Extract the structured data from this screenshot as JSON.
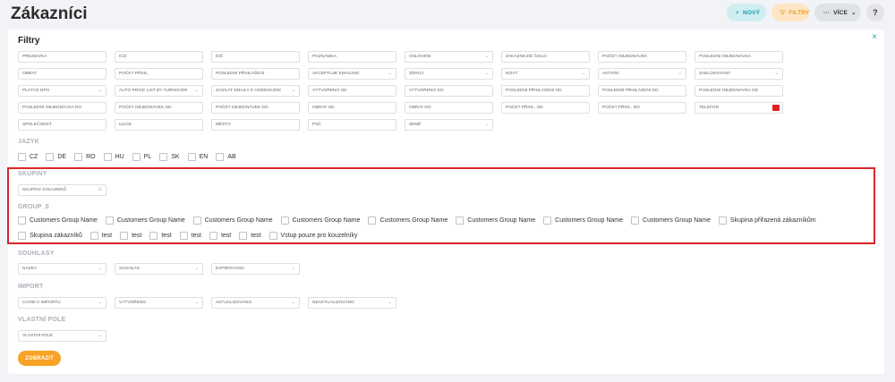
{
  "header": {
    "title": "Zákazníci",
    "new_label": "NOVÝ",
    "filters_label": "FILTRY",
    "more_label": "VÍCE",
    "help_label": "?"
  },
  "panel": {
    "title": "Filtry",
    "close_label": "×",
    "submit_label": "ZOBRAZIT"
  },
  "fields": {
    "row1": [
      "PŘEZDÍVKA",
      "IČO",
      "DIČ",
      "POZNÁMKA",
      "OSLOVENÍ",
      "ZÁKAZNICKÉ ČÍSLO",
      "POČET OBJEDNÁVEK",
      "POSLEDNÍ OBJEDNÁVKA"
    ],
    "row2": [
      "OBRAT",
      "POČET PŘIHL.",
      "POSLEDNÍ PŘIHLÁŠENÍ",
      "AKCEPTUJE EMAILING",
      "ZDROJ",
      "NOVÝ",
      "AKTIVNÍ",
      "ZABLOKOVANÝ"
    ],
    "row3": [
      "PLÁTCE DPH",
      "AUTO PRICE LIST BY TURNOVER",
      "ZASÍLAT EMAILY K HODNOCENÍ",
      "VYTVOŘENO OD",
      "VYTVOŘENO DO",
      "POSLEDNÍ PŘIHLÁŠENÍ OD",
      "POSLEDNÍ PŘIHLÁŠENÍ DO",
      "POSLEDNÍ OBJEDNÁVKA OD"
    ],
    "row4": [
      "POSLEDNÍ OBJEDNÁVKA DO",
      "POČET OBJEDNÁVEK OD",
      "POČET OBJEDNÁVEK DO",
      "OBRAT OD",
      "OBRAT DO",
      "POČET PŘIHL. OD",
      "POČET PŘIHL. DO",
      "TELEFON"
    ],
    "row5": [
      "SPOLEČNOST",
      "ULICE",
      "MĚSTO",
      "PSČ",
      "ZEMĚ"
    ]
  },
  "jazyk": {
    "label": "JAZYK",
    "options": [
      "CZ",
      "DE",
      "RO",
      "HU",
      "PL",
      "SK",
      "EN",
      "AB"
    ]
  },
  "skupiny": {
    "label": "SKUPINY",
    "field": "SKUPINY ZÁKAZNÍKŮ"
  },
  "group0": {
    "label": "GROUP_0",
    "row1": [
      "Customers Group Name",
      "Customers Group Name",
      "Customers Group Name",
      "Customers Group Name",
      "Customers Group Name",
      "Customers Group Name",
      "Customers Group Name",
      "Customers Group Name",
      "Skupina přiřazená zákazníkům"
    ],
    "row2": [
      "Skupina zákazníků",
      "test",
      "test",
      "test",
      "test",
      "test",
      "test",
      "Vstup pouze pro kouzelníky"
    ]
  },
  "souhlasy": {
    "label": "SOUHLASY",
    "fields": [
      "NÁZEV",
      "SOUHLAS",
      "EXPIROVÁNO"
    ]
  },
  "import": {
    "label": "IMPORT",
    "fields": [
      "CHYBÍ V IMPORTU",
      "VYTVOŘENO",
      "AKTUALIZOVÁNO",
      "NEAKTUALIZOVÁNO"
    ]
  },
  "vlastni_pole": {
    "label": "VLASTNÍ POLE",
    "field": "VLASTNÍ POLE"
  },
  "colors": {
    "accent": "#1e9aa8",
    "orange": "#f7a327",
    "highlight": "#d9262a"
  }
}
